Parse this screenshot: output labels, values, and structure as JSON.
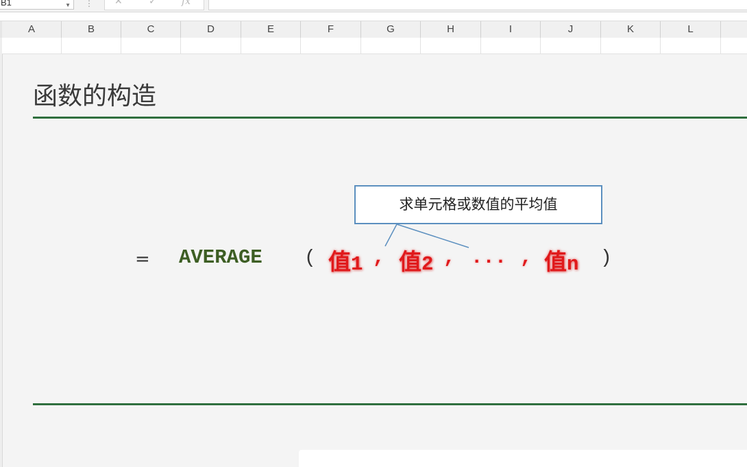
{
  "formula_bar": {
    "name_box": "B1",
    "cancel_icon": "✕",
    "enter_icon": "✓",
    "fx_label": "fx",
    "separator": "⋮"
  },
  "columns": [
    "A",
    "B",
    "C",
    "D",
    "E",
    "F",
    "G",
    "H",
    "I",
    "J",
    "K",
    "L"
  ],
  "slide": {
    "title": "函数的构造",
    "callout": "求单元格或数值的平均值",
    "formula": {
      "equals": "=",
      "function_name": "AVERAGE",
      "open_paren": "(",
      "arg1_cjk": "值",
      "arg1_num": "1",
      "comma1": ",",
      "arg2_cjk": "值",
      "arg2_num": "2",
      "comma2": ",",
      "ellipsis": "...",
      "comma3": ",",
      "argn_cjk": "值",
      "argn_num": "n",
      "close_paren": ")"
    }
  },
  "colors": {
    "title_rule": "#2f6f3e",
    "function_name": "#3d5e24",
    "argument": "#e0191b",
    "callout_border": "#5b8fbf"
  }
}
